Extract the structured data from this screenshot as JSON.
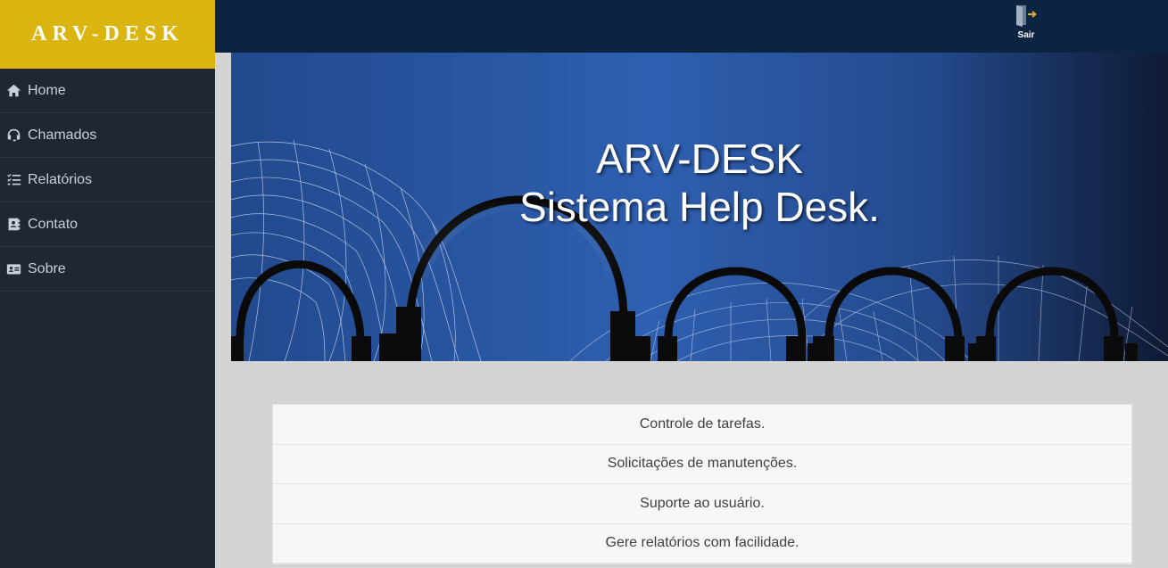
{
  "brand": {
    "title": "ARV-DESK",
    "color": "#dab510"
  },
  "sidebar": {
    "items": [
      {
        "label": "Home",
        "icon": "home-icon"
      },
      {
        "label": "Chamados",
        "icon": "headset-icon"
      },
      {
        "label": "Relatórios",
        "icon": "tasks-icon"
      },
      {
        "label": "Contato",
        "icon": "address-book-icon"
      },
      {
        "label": "Sobre",
        "icon": "id-card-icon"
      }
    ]
  },
  "topbar": {
    "logout_label": "Sair",
    "logout_icon": "door-exit-icon"
  },
  "banner": {
    "line1": "ARV-DESK",
    "line2": "Sistema Help Desk."
  },
  "features": [
    "Controle de tarefas.",
    "Solicitações de manutenções.",
    "Suporte ao usuário.",
    "Gere relatórios com facilidade."
  ]
}
